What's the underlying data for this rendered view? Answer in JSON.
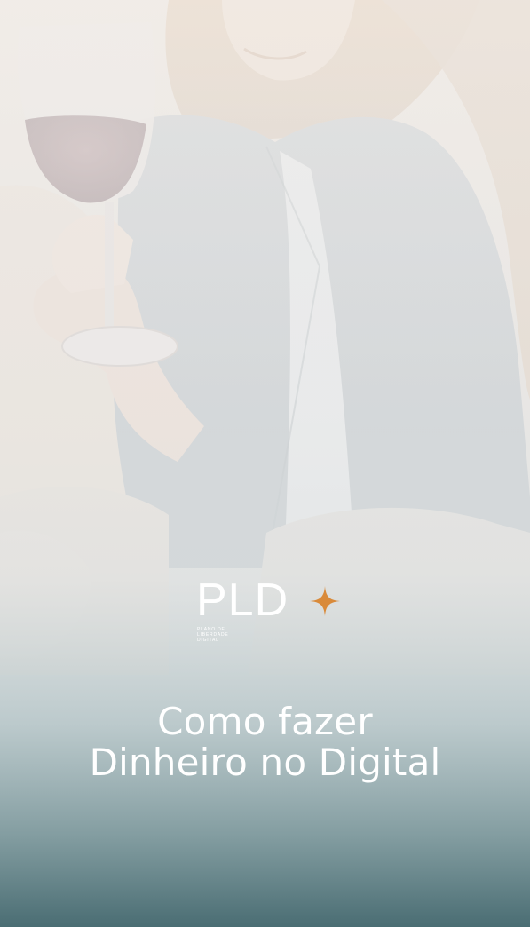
{
  "brand": {
    "logo_text": "PLD",
    "tagline_lines": [
      "PLANO DE",
      "LIBERDADE",
      "DIGITAL"
    ],
    "accent_color": "#d98a3a"
  },
  "headline": {
    "line1": "Como fazer",
    "line2": "Dinheiro no Digital"
  },
  "colors": {
    "overlay_top": "#f1eeea",
    "overlay_bottom": "#4a7076",
    "text": "#ffffff"
  }
}
